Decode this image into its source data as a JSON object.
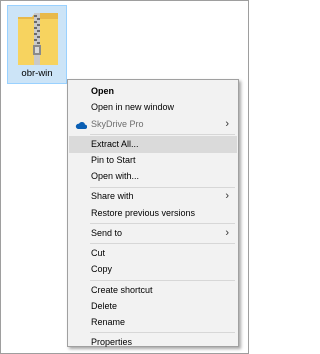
{
  "desktop": {
    "file_label": "obr-win"
  },
  "menu": {
    "items": [
      {
        "label": "Open",
        "bold": true
      },
      {
        "label": "Open in new window"
      },
      {
        "label": "SkyDrive Pro",
        "icon": "cloud-icon",
        "submenu": true,
        "disabled": true
      },
      {
        "label": "Extract All...",
        "highlighted": true
      },
      {
        "label": "Pin to Start"
      },
      {
        "label": "Open with..."
      },
      {
        "label": "Share with",
        "submenu": true
      },
      {
        "label": "Restore previous versions"
      },
      {
        "label": "Send to",
        "submenu": true
      },
      {
        "label": "Cut"
      },
      {
        "label": "Copy"
      },
      {
        "label": "Create shortcut"
      },
      {
        "label": "Delete"
      },
      {
        "label": "Rename"
      },
      {
        "label": "Properties"
      }
    ]
  },
  "colors": {
    "selection_bg": "#cce4f7",
    "menu_bg": "#f2f2f2",
    "highlight_bg": "#dadada",
    "skydrive_blue": "#0a5fb4"
  }
}
